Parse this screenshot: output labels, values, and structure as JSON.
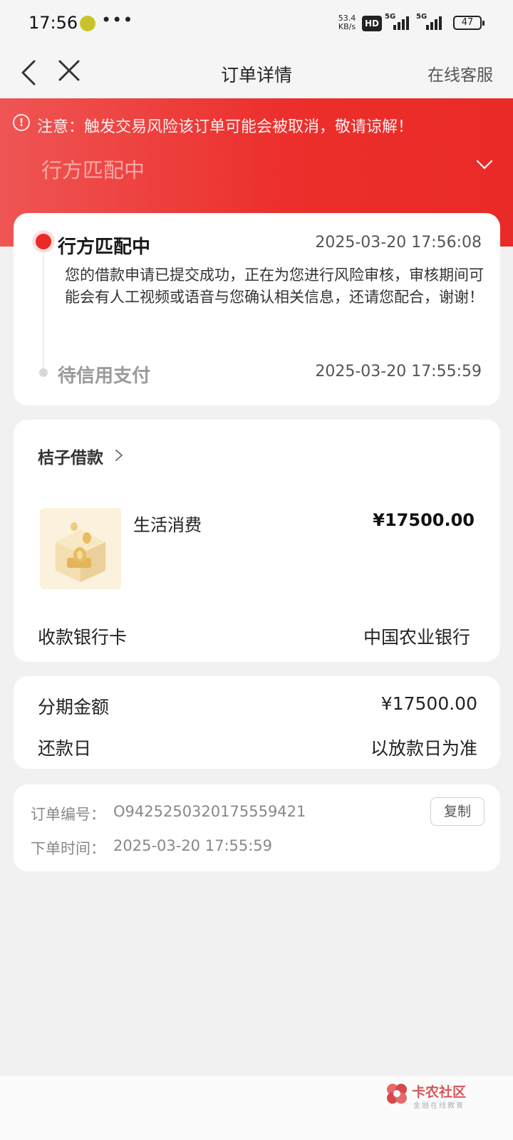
{
  "status_bar": {
    "time": "17:56",
    "more": "•••",
    "net_speed_value": "53.4",
    "net_speed_unit": "KB/s",
    "hd": "HD",
    "signal1_type": "5G",
    "signal2_type": "5G",
    "battery": "47"
  },
  "nav": {
    "title": "订单详情",
    "service": "在线客服"
  },
  "banner": {
    "warning_icon": "!",
    "warning": "注意：触发交易风险该订单可能会被取消，敬请谅解！",
    "status": "行方匹配中"
  },
  "timeline": {
    "steps": [
      {
        "title": "行方匹配中",
        "time": "2025-03-20 17:56:08",
        "description": "您的借款申请已提交成功，正在为您进行风险审核，审核期间可能会有人工视频或语音与您确认相关信息，还请您配合，谢谢！"
      },
      {
        "title": "待信用支付",
        "time": "2025-03-20 17:55:59"
      }
    ]
  },
  "product": {
    "merchant": "桔子借款",
    "name": "生活消费",
    "price": "¥17500.00",
    "bank_label": "收款银行卡",
    "bank_value": "中国农业银行"
  },
  "installment": {
    "amount_label": "分期金额",
    "amount_value": "¥17500.00",
    "repay_label": "还款日",
    "repay_value": "以放款日为准"
  },
  "order": {
    "no_label": "订单编号：",
    "no_value": "O942525032017555942​1",
    "copy_label": "复制",
    "time_label": "下单时间：",
    "time_value": "2025-03-20 17:55:59"
  },
  "watermark": {
    "title": "卡农社区",
    "subtitle": "金融在线教育"
  },
  "colors": {
    "accent": "#ea2a26",
    "banner_start": "#ef5554",
    "page_bg": "#f1f1f1"
  }
}
